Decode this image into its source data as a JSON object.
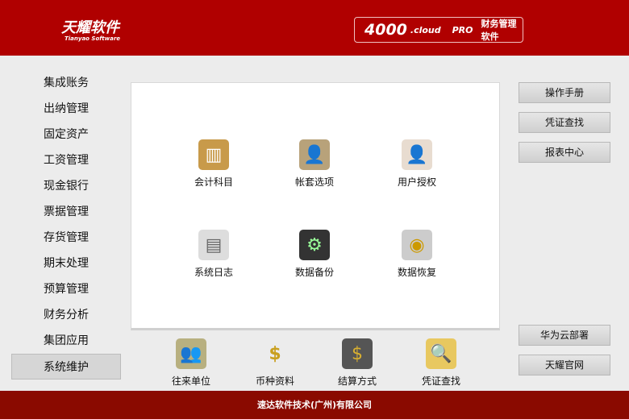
{
  "header": {
    "logo": "天耀软件",
    "logo_sub": "Tianyao Software",
    "brand_num": "4000",
    "brand_cloud": ".cloud",
    "brand_pro": "PRO",
    "brand_title": "财务管理软件"
  },
  "sidebar": {
    "items": [
      "集成账务",
      "出纳管理",
      "固定资产",
      "工资管理",
      "现金银行",
      "票据管理",
      "存货管理",
      "期末处理",
      "预算管理",
      "财务分析",
      "集团应用",
      "系统维护"
    ],
    "selected": "系统维护"
  },
  "panel": {
    "tiles": [
      {
        "label": "会计科目",
        "icon": "books-icon"
      },
      {
        "label": "帐套选项",
        "icon": "folder-user-icon"
      },
      {
        "label": "用户授权",
        "icon": "user-check-icon"
      },
      {
        "label": "系统日志",
        "icon": "document-icon"
      },
      {
        "label": "数据备份",
        "icon": "backup-gear-icon"
      },
      {
        "label": "数据恢复",
        "icon": "database-restore-icon"
      }
    ]
  },
  "bottom": {
    "items": [
      {
        "label": "往来单位",
        "icon": "contacts-icon"
      },
      {
        "label": "币种资料",
        "icon": "currency-icon"
      },
      {
        "label": "结算方式",
        "icon": "pos-terminal-icon"
      },
      {
        "label": "凭证查找",
        "icon": "folder-search-icon"
      }
    ]
  },
  "right": {
    "top": [
      "操作手册",
      "凭证查找",
      "报表中心"
    ],
    "bottom": [
      "华为云部署",
      "天耀官网"
    ]
  },
  "footer": {
    "text": "速达软件技术(广州)有限公司"
  }
}
